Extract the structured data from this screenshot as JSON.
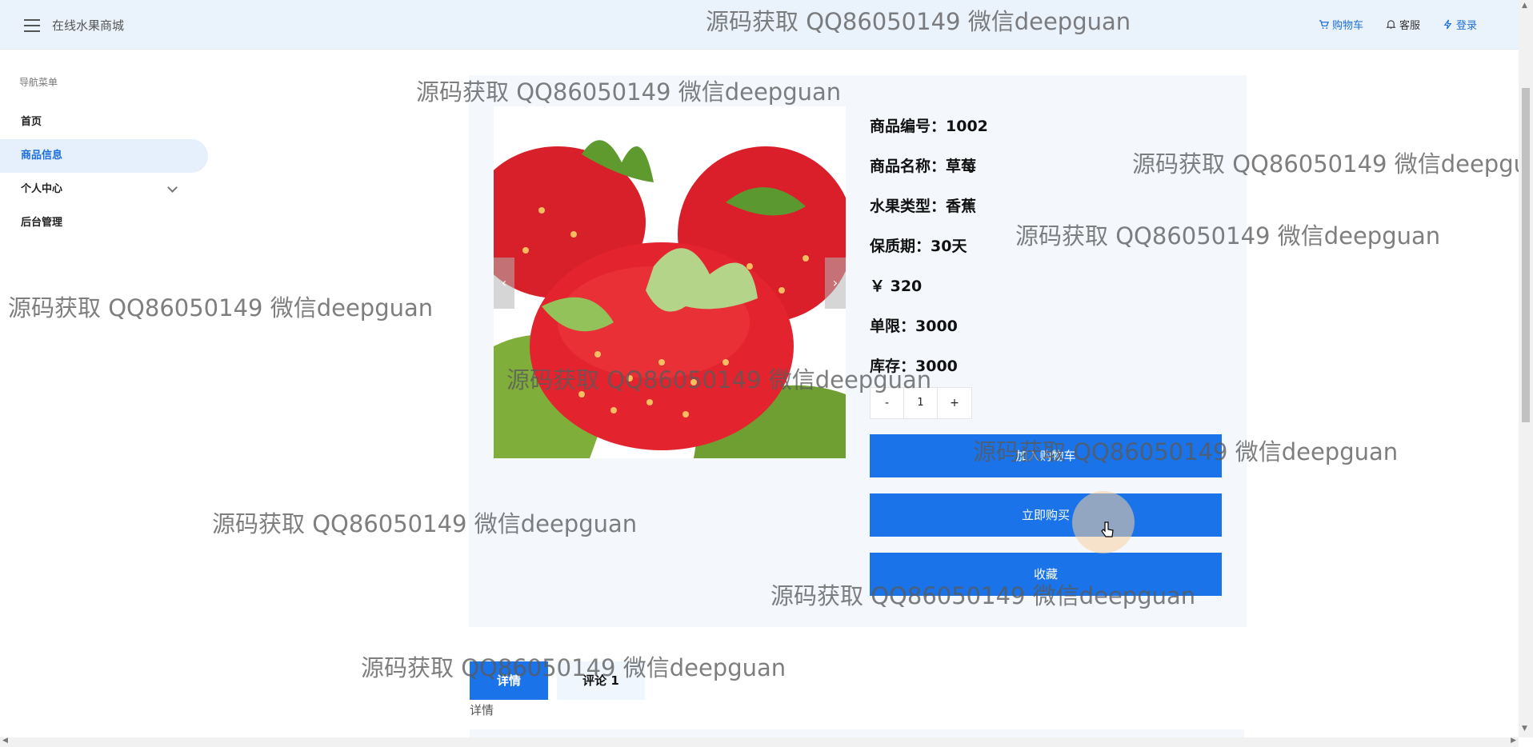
{
  "header": {
    "app_title": "在线水果商城",
    "links": [
      {
        "label": "购物车",
        "icon": "cart-icon"
      },
      {
        "label": "客服",
        "icon": "bell-icon"
      },
      {
        "label": "登录",
        "icon": "bolt-icon"
      }
    ]
  },
  "sidebar": {
    "heading": "导航菜单",
    "items": [
      {
        "label": "首页"
      },
      {
        "label": "商品信息",
        "active": true
      },
      {
        "label": "个人中心",
        "has_submenu": true
      },
      {
        "label": "后台管理"
      }
    ]
  },
  "product": {
    "image_alt": "strawberries",
    "info": [
      {
        "label": "商品编号：1002"
      },
      {
        "label": "商品名称：草莓"
      },
      {
        "label": "水果类型：香蕉"
      },
      {
        "label": "保质期：30天"
      },
      {
        "label": "￥ 320"
      },
      {
        "label": "单限：3000"
      },
      {
        "label": "库存：3000"
      }
    ],
    "stepper": {
      "minus": "-",
      "quantity": "1",
      "plus": "+"
    },
    "buttons": {
      "add_to_cart": "加入购物车",
      "buy_now": "立即购买",
      "favorite": "收藏"
    }
  },
  "tabs": [
    {
      "label": "详情",
      "active": true
    },
    {
      "label": "评论 1",
      "active": false
    }
  ],
  "detail_label": "详情",
  "watermark": "源码获取 QQ86050149 微信deepguan",
  "colors": {
    "accent": "#1a73e8",
    "header_bg": "#eaf2fc",
    "panel_bg": "#f4f8fd"
  }
}
